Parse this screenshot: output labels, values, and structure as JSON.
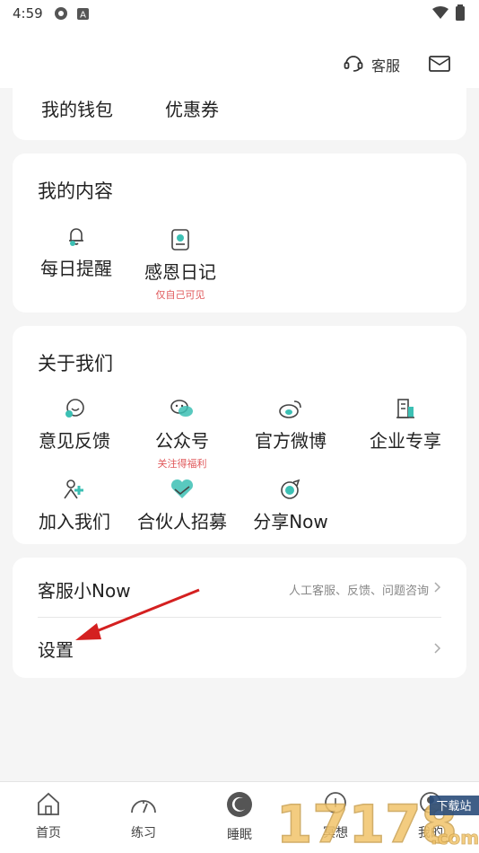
{
  "status_bar": {
    "time": "4:59"
  },
  "header": {
    "service_label": "客服"
  },
  "wallet": {
    "items": [
      {
        "label": "我的钱包"
      },
      {
        "label": "优惠券"
      }
    ]
  },
  "my_content": {
    "title": "我的内容",
    "items": [
      {
        "label": "每日提醒",
        "icon": "bell-icon"
      },
      {
        "label": "感恩日记",
        "sub": "仅自己可见",
        "icon": "diary-icon"
      }
    ]
  },
  "about": {
    "title": "关于我们",
    "items": [
      {
        "label": "意见反馈",
        "icon": "feedback-icon"
      },
      {
        "label": "公众号",
        "sub": "关注得福利",
        "icon": "wechat-icon"
      },
      {
        "label": "官方微博",
        "icon": "weibo-icon"
      },
      {
        "label": "企业专享",
        "icon": "enterprise-icon"
      },
      {
        "label": "加入我们",
        "icon": "join-icon"
      },
      {
        "label": "合伙人招募",
        "icon": "partner-icon"
      },
      {
        "label": "分享Now",
        "icon": "share-icon"
      }
    ]
  },
  "support": {
    "service_title": "客服小Now",
    "service_hint": "人工客服、反馈、问题咨询",
    "settings_title": "设置"
  },
  "tabs": [
    {
      "label": "首页",
      "icon": "home-icon"
    },
    {
      "label": "练习",
      "icon": "gauge-icon"
    },
    {
      "label": "睡眠",
      "icon": "moon-icon"
    },
    {
      "label": "冥想",
      "icon": "meditation-icon"
    },
    {
      "label": "我的",
      "icon": "profile-icon"
    }
  ],
  "watermark": {
    "text": "17178",
    "badge": "下载站",
    "suffix": ".com"
  },
  "colors": {
    "accent": "#3cc0b4",
    "tag": "#e0595b",
    "arrow": "#d42020"
  }
}
